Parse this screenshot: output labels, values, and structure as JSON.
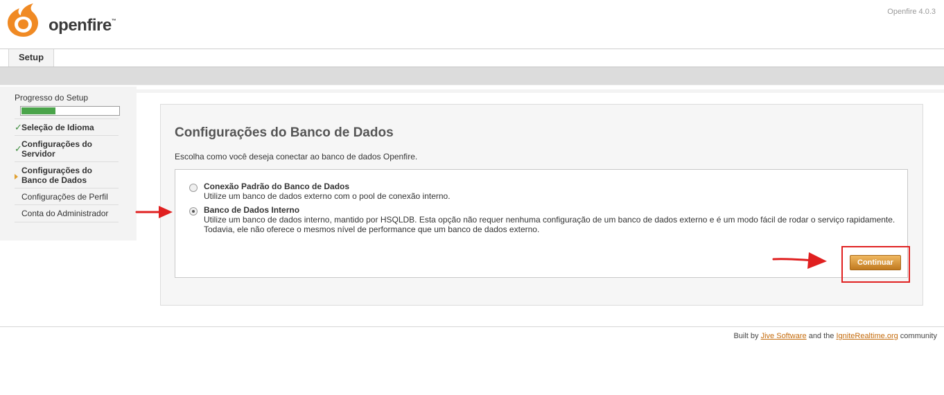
{
  "header": {
    "logo_text": "openfire",
    "logo_tm": "™",
    "version": "Openfire 4.0.3"
  },
  "tabs": [
    {
      "label": "Setup",
      "active": true
    }
  ],
  "sidebar": {
    "progress_label": "Progresso do Setup",
    "progress_fraction": 0.35,
    "items": [
      {
        "label": "Seleção de Idioma",
        "state": "done"
      },
      {
        "label": "Configurações do Servidor",
        "state": "done"
      },
      {
        "label": "Configurações do Banco de Dados",
        "state": "current"
      },
      {
        "label": "Configurações de Perfil",
        "state": "pending"
      },
      {
        "label": "Conta do Administrador",
        "state": "pending"
      }
    ]
  },
  "main": {
    "title": "Configurações do Banco de Dados",
    "description": "Escolha como você deseja conectar ao banco de dados Openfire.",
    "options": [
      {
        "title": "Conexão Padrão do Banco de Dados",
        "description": "Utilize um banco de dados externo com o pool de conexão interno.",
        "selected": false
      },
      {
        "title": "Banco de Dados Interno",
        "description": "Utilize um banco de dados interno, mantido por HSQLDB. Esta opção não requer nenhuma configuração de um banco de dados externo e é um modo fácil de rodar o serviço rapidamente. Todavia, ele não oferece o mesmos nível de performance que um banco de dados externo.",
        "selected": true
      }
    ],
    "continue_label": "Continuar"
  },
  "footer": {
    "prefix": "Built by ",
    "link1": "Jive Software",
    "middle": " and the ",
    "link2": "IgniteRealtime.org",
    "suffix": " community"
  },
  "colors": {
    "accent_orange": "#c46a0a",
    "progress_green": "#4aa44a",
    "annotation_red": "#e02020"
  }
}
